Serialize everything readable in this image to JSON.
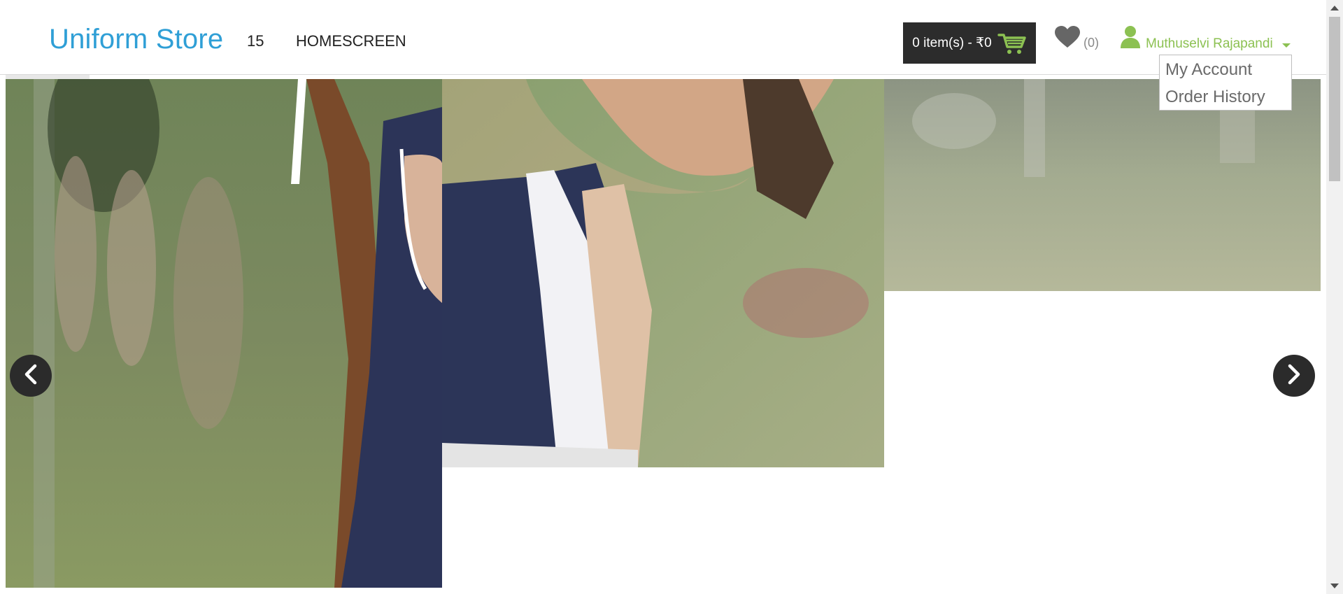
{
  "header": {
    "logo": "Uniform Store",
    "nav": [
      {
        "label": "15"
      },
      {
        "label": "HOMESCREEN"
      }
    ],
    "cart_label": "0 item(s) - ₹0",
    "wishlist_count": "(0)",
    "user_name": "Muthuselvi Rajapandi"
  },
  "user_menu": {
    "items": [
      {
        "label": "My Account"
      },
      {
        "label": "Order History"
      }
    ]
  },
  "colors": {
    "brand": "#2f9fd6",
    "user_accent": "#8cc152",
    "cart_bg": "#2c2c2c"
  },
  "icons": {
    "cart": "cart-icon",
    "wishlist": "heart-icon",
    "user": "user-icon",
    "prev": "chevron-left-icon",
    "next": "chevron-right-icon"
  }
}
